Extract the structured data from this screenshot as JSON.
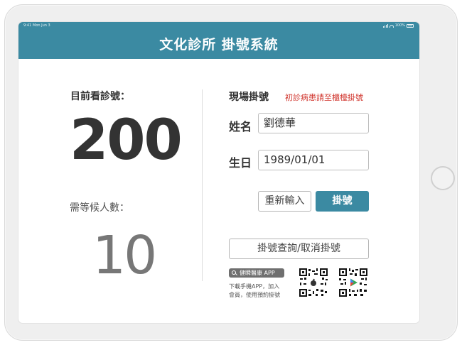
{
  "status_bar": {
    "time": "9:41",
    "date": "Mon Jun 3",
    "battery": "100%"
  },
  "header": {
    "title": "文化診所 掛號系統",
    "bg_color": "#3b8aa2"
  },
  "current": {
    "label": "目前看診號：",
    "number": "200"
  },
  "waiting": {
    "label": "需等候人數：",
    "count": "10"
  },
  "registration": {
    "title": "現場掛號",
    "notice": "初診病患請至櫃檯掛號",
    "notice_color": "#d0342c",
    "name_label": "姓名",
    "name_value": "劉德華",
    "birthday_label": "生日",
    "birthday_value": "1989/01/01",
    "reset_button": "重新輸入",
    "register_button": "掛號",
    "query_button": "掛號查詢/取消掛號"
  },
  "app": {
    "badge_label": "健瞬醫康 APP",
    "desc_line1": "下載手機APP，加入",
    "desc_line2": "會員，使用預約掛號",
    "qr_codes": [
      {
        "icon": "apple-icon"
      },
      {
        "icon": "google-play-icon"
      }
    ]
  }
}
